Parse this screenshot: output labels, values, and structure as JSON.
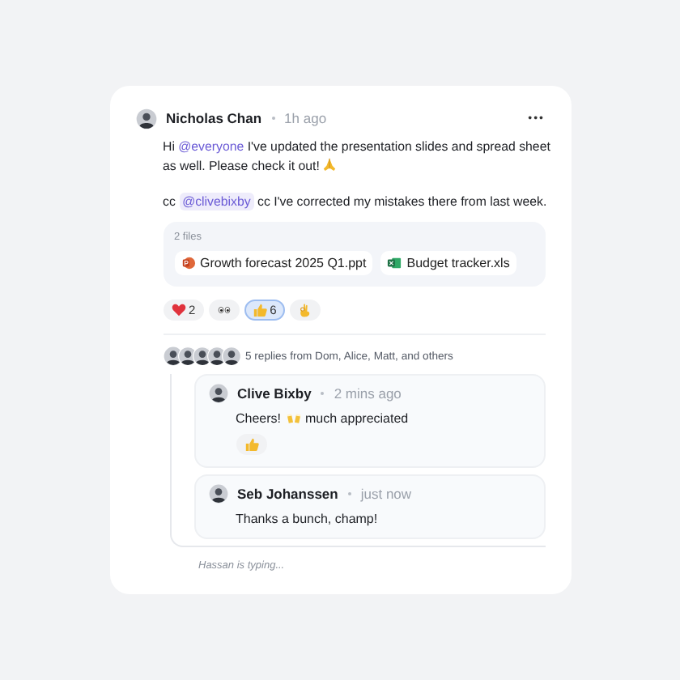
{
  "post": {
    "author": "Nicholas Chan",
    "time": "1h ago",
    "menu": "•••",
    "paragraphs": [
      [
        {
          "kind": "text",
          "text": "Hi "
        },
        {
          "kind": "mention",
          "text": "@everyone"
        },
        {
          "kind": "text",
          "text": " I've updated the presentation slides and spread sheet as well. Please check it out!"
        },
        {
          "kind": "pray"
        }
      ],
      [
        {
          "kind": "text",
          "text": "cc "
        },
        {
          "kind": "mention",
          "text": "@clivebixby"
        },
        {
          "kind": "text",
          "text": " cc I've corrected my mistakes there from last week."
        }
      ]
    ],
    "files_label": "2 files",
    "files": [
      {
        "kind": "ppt",
        "name": "Growth forecast 2025 Q1.ppt"
      },
      {
        "kind": "xls",
        "name": "Budget tracker.xls"
      }
    ],
    "reactions": [
      {
        "kind": "heart",
        "count": "2",
        "selected": false
      },
      {
        "kind": "eyes",
        "selected": false
      },
      {
        "kind": "thumb",
        "count": "6",
        "selected": true
      },
      {
        "kind": "ok",
        "selected": false
      }
    ]
  },
  "thread": {
    "summary": "5 replies from Dom, Alice, Matt, and others",
    "avatars": [
      {
        "kind": "person"
      },
      {
        "kind": "person"
      },
      {
        "kind": "person"
      },
      {
        "kind": "person"
      },
      {
        "kind": "person"
      }
    ],
    "replies": [
      {
        "author": "Clive Bixby",
        "time": "2 mins ago",
        "segments": [
          {
            "kind": "text",
            "text": "Cheers!"
          },
          {
            "kind": "cheers"
          },
          {
            "kind": "text",
            "text": "much appreciated"
          }
        ],
        "reactions": [
          {
            "kind": "thumb",
            "selected": false
          }
        ]
      },
      {
        "author": "Seb Johanssen",
        "time": "just now",
        "segments": [
          {
            "kind": "text",
            "text": "Thanks a bunch, champ!"
          }
        ]
      }
    ]
  },
  "typing": "Hassan is typing..."
}
